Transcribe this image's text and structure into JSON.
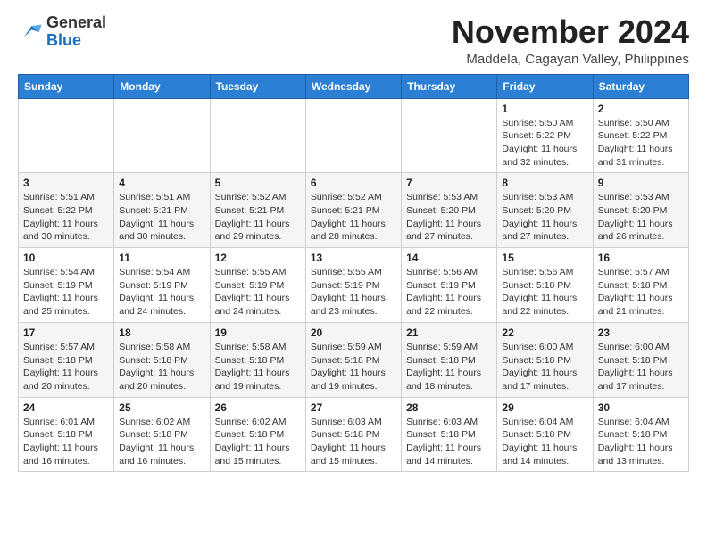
{
  "header": {
    "logo_general": "General",
    "logo_blue": "Blue",
    "month_title": "November 2024",
    "location": "Maddela, Cagayan Valley, Philippines"
  },
  "calendar": {
    "days_of_week": [
      "Sunday",
      "Monday",
      "Tuesday",
      "Wednesday",
      "Thursday",
      "Friday",
      "Saturday"
    ],
    "weeks": [
      [
        {
          "day": "",
          "info": ""
        },
        {
          "day": "",
          "info": ""
        },
        {
          "day": "",
          "info": ""
        },
        {
          "day": "",
          "info": ""
        },
        {
          "day": "",
          "info": ""
        },
        {
          "day": "1",
          "info": "Sunrise: 5:50 AM\nSunset: 5:22 PM\nDaylight: 11 hours and 32 minutes."
        },
        {
          "day": "2",
          "info": "Sunrise: 5:50 AM\nSunset: 5:22 PM\nDaylight: 11 hours and 31 minutes."
        }
      ],
      [
        {
          "day": "3",
          "info": "Sunrise: 5:51 AM\nSunset: 5:22 PM\nDaylight: 11 hours and 30 minutes."
        },
        {
          "day": "4",
          "info": "Sunrise: 5:51 AM\nSunset: 5:21 PM\nDaylight: 11 hours and 30 minutes."
        },
        {
          "day": "5",
          "info": "Sunrise: 5:52 AM\nSunset: 5:21 PM\nDaylight: 11 hours and 29 minutes."
        },
        {
          "day": "6",
          "info": "Sunrise: 5:52 AM\nSunset: 5:21 PM\nDaylight: 11 hours and 28 minutes."
        },
        {
          "day": "7",
          "info": "Sunrise: 5:53 AM\nSunset: 5:20 PM\nDaylight: 11 hours and 27 minutes."
        },
        {
          "day": "8",
          "info": "Sunrise: 5:53 AM\nSunset: 5:20 PM\nDaylight: 11 hours and 27 minutes."
        },
        {
          "day": "9",
          "info": "Sunrise: 5:53 AM\nSunset: 5:20 PM\nDaylight: 11 hours and 26 minutes."
        }
      ],
      [
        {
          "day": "10",
          "info": "Sunrise: 5:54 AM\nSunset: 5:19 PM\nDaylight: 11 hours and 25 minutes."
        },
        {
          "day": "11",
          "info": "Sunrise: 5:54 AM\nSunset: 5:19 PM\nDaylight: 11 hours and 24 minutes."
        },
        {
          "day": "12",
          "info": "Sunrise: 5:55 AM\nSunset: 5:19 PM\nDaylight: 11 hours and 24 minutes."
        },
        {
          "day": "13",
          "info": "Sunrise: 5:55 AM\nSunset: 5:19 PM\nDaylight: 11 hours and 23 minutes."
        },
        {
          "day": "14",
          "info": "Sunrise: 5:56 AM\nSunset: 5:19 PM\nDaylight: 11 hours and 22 minutes."
        },
        {
          "day": "15",
          "info": "Sunrise: 5:56 AM\nSunset: 5:18 PM\nDaylight: 11 hours and 22 minutes."
        },
        {
          "day": "16",
          "info": "Sunrise: 5:57 AM\nSunset: 5:18 PM\nDaylight: 11 hours and 21 minutes."
        }
      ],
      [
        {
          "day": "17",
          "info": "Sunrise: 5:57 AM\nSunset: 5:18 PM\nDaylight: 11 hours and 20 minutes."
        },
        {
          "day": "18",
          "info": "Sunrise: 5:58 AM\nSunset: 5:18 PM\nDaylight: 11 hours and 20 minutes."
        },
        {
          "day": "19",
          "info": "Sunrise: 5:58 AM\nSunset: 5:18 PM\nDaylight: 11 hours and 19 minutes."
        },
        {
          "day": "20",
          "info": "Sunrise: 5:59 AM\nSunset: 5:18 PM\nDaylight: 11 hours and 19 minutes."
        },
        {
          "day": "21",
          "info": "Sunrise: 5:59 AM\nSunset: 5:18 PM\nDaylight: 11 hours and 18 minutes."
        },
        {
          "day": "22",
          "info": "Sunrise: 6:00 AM\nSunset: 5:18 PM\nDaylight: 11 hours and 17 minutes."
        },
        {
          "day": "23",
          "info": "Sunrise: 6:00 AM\nSunset: 5:18 PM\nDaylight: 11 hours and 17 minutes."
        }
      ],
      [
        {
          "day": "24",
          "info": "Sunrise: 6:01 AM\nSunset: 5:18 PM\nDaylight: 11 hours and 16 minutes."
        },
        {
          "day": "25",
          "info": "Sunrise: 6:02 AM\nSunset: 5:18 PM\nDaylight: 11 hours and 16 minutes."
        },
        {
          "day": "26",
          "info": "Sunrise: 6:02 AM\nSunset: 5:18 PM\nDaylight: 11 hours and 15 minutes."
        },
        {
          "day": "27",
          "info": "Sunrise: 6:03 AM\nSunset: 5:18 PM\nDaylight: 11 hours and 15 minutes."
        },
        {
          "day": "28",
          "info": "Sunrise: 6:03 AM\nSunset: 5:18 PM\nDaylight: 11 hours and 14 minutes."
        },
        {
          "day": "29",
          "info": "Sunrise: 6:04 AM\nSunset: 5:18 PM\nDaylight: 11 hours and 14 minutes."
        },
        {
          "day": "30",
          "info": "Sunrise: 6:04 AM\nSunset: 5:18 PM\nDaylight: 11 hours and 13 minutes."
        }
      ]
    ]
  }
}
